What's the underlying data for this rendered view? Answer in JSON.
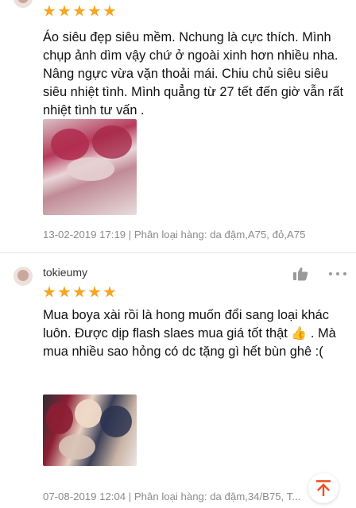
{
  "colors": {
    "star": "#f5a623",
    "meta_text": "#8a8a8a",
    "scroll_top_icon": "#f04e23"
  },
  "reviews": [
    {
      "username": "",
      "rating": 5,
      "text": "Áo siêu đẹp siêu mềm. Nchung là cực thích. Mình chụp ảnh dìm vậy chứ ở ngoài xinh hơn nhiều nha. Nâng ngực vừa vặn thoải mái. Chiu chủ siêu siêu siêu nhiệt tình. Mình quẳng từ 27 tết đến giờ vẫn rất nhiệt tình tư vấn .",
      "meta": "13-02-2019 17:19 | Phân loại hàng: da đậm,A75, đỏ,A75"
    },
    {
      "username": "tokieumy",
      "rating": 5,
      "text_part1": "Mua boya xài rồi là hong muốn đổi sang loại khác luôn. Được dịp flash slaes mua giá tốt thật",
      "emoji": "👍",
      "text_part2": " . Mà mua nhiều sao hỏng có dc tặng gì hết bùn ghê :(",
      "meta": "07-08-2019 12:04 | Phân loại hàng: da đậm,34/B75, T..."
    }
  ],
  "icons": {
    "like": "thumbs-up-icon",
    "more": "more-options-icon",
    "scroll_top": "scroll-to-top-icon"
  }
}
